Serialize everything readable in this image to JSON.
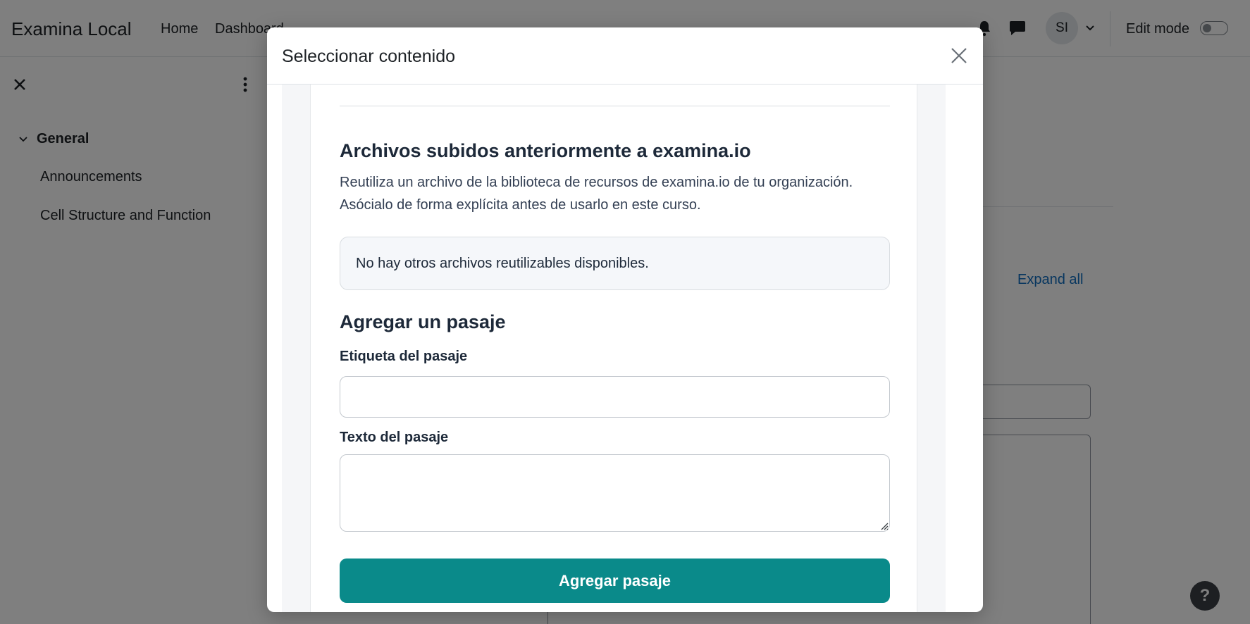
{
  "navbar": {
    "brand": "Examina Local",
    "links": [
      "Home",
      "Dashboard"
    ],
    "avatar_initials": "SI",
    "edit_mode_label": "Edit mode",
    "edit_mode_on": false
  },
  "drawer": {
    "section": "General",
    "items": [
      "Announcements",
      "Cell Structure and Function"
    ]
  },
  "main": {
    "expand_all": "Expand all",
    "help": "?"
  },
  "modal": {
    "title": "Seleccionar contenido",
    "files_title": "Archivos subidos anteriormente a examina.io",
    "files_description": "Reutiliza un archivo de la biblioteca de recursos de examina.io de tu organización. Asócialo de forma explícita antes de usarlo en este curso.",
    "files_empty": "No hay otros archivos reutilizables disponibles.",
    "passage_title": "Agregar un pasaje",
    "label_field": "Etiqueta del pasaje",
    "label_value": "",
    "text_field": "Texto del pasaje",
    "text_value": "",
    "add_button": "Agregar pasaje"
  },
  "colors": {
    "accent": "#0a8a8a",
    "link": "#0f6cbf",
    "overlay": "rgba(0,0,0,0.5)"
  },
  "icons": [
    "bell-icon",
    "chat-icon",
    "chevron-down-icon",
    "close-icon",
    "kebab-icon",
    "resize-grip-icon"
  ]
}
